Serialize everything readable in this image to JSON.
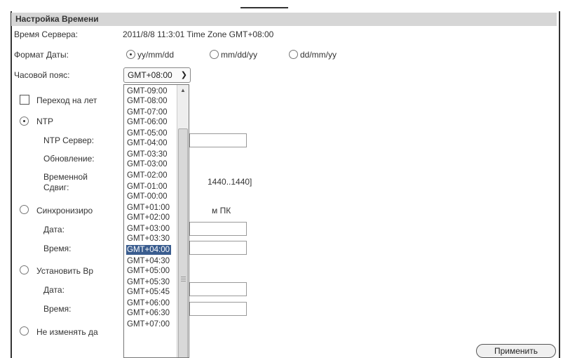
{
  "section_title": "Настройка Времени",
  "server_time": {
    "label": "Время Сервера:",
    "value": "2011/8/8 11:3:01 Time Zone GMT+08:00"
  },
  "date_format": {
    "label": "Формат Даты:",
    "options": [
      "yy/mm/dd",
      "mm/dd/yy",
      "dd/mm/yy"
    ],
    "selected": "yy/mm/dd"
  },
  "timezone": {
    "label": "Часовой пояс:",
    "selected": "GMT+08:00",
    "options": [
      "GMT-09:00",
      "GMT-08:00",
      "GMT-07:00",
      "GMT-06:00",
      "GMT-05:00",
      "GMT-04:00",
      "GMT-03:30",
      "GMT-03:00",
      "GMT-02:00",
      "GMT-01:00",
      "GMT-00:00",
      "GMT+01:00",
      "GMT+02:00",
      "GMT+03:00",
      "GMT+03:30",
      "GMT+04:00",
      "GMT+04:30",
      "GMT+05:00",
      "GMT+05:30",
      "GMT+05:45",
      "GMT+06:00",
      "GMT+06:30",
      "GMT+07:00"
    ],
    "highlighted": "GMT+04:00"
  },
  "dst": {
    "label": "Переход на лет"
  },
  "ntp": {
    "label": "NTP",
    "server_label": "NTP Сервер:",
    "update_label": "Обновление:",
    "offset_label_1": "Временной",
    "offset_label_2": "Сдвиг:",
    "offset_range": "1440..1440]"
  },
  "sync_pc": {
    "label": "Синхронизиро",
    "suffix": "м ПК",
    "date_label": "Дата:",
    "time_label": "Время:"
  },
  "manual": {
    "label": "Установить Вр",
    "date_label": "Дата:",
    "time_label": "Время:"
  },
  "no_change": {
    "label": "Не изменять да"
  },
  "apply_button": "Применить"
}
